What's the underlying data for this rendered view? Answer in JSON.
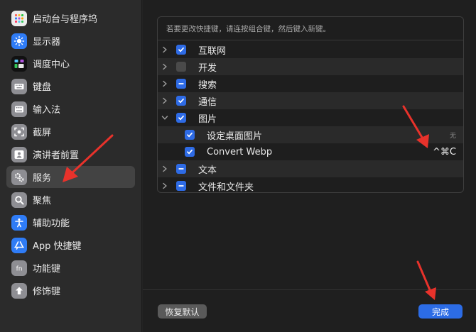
{
  "sidebar": {
    "items": [
      {
        "label": "启动台与程序坞",
        "icon": "launchpad-icon",
        "color": "#e8e8e8"
      },
      {
        "label": "显示器",
        "icon": "display-icon",
        "color": "#2f7cf6"
      },
      {
        "label": "调度中心",
        "icon": "mission-control-icon",
        "color": "#111111"
      },
      {
        "label": "键盘",
        "icon": "keyboard-icon",
        "color": "#8e8e93"
      },
      {
        "label": "输入法",
        "icon": "input-method-icon",
        "color": "#8e8e93"
      },
      {
        "label": "截屏",
        "icon": "screenshot-icon",
        "color": "#8e8e93"
      },
      {
        "label": "演讲者前置",
        "icon": "presenter-icon",
        "color": "#8e8e93"
      },
      {
        "label": "服务",
        "icon": "services-gear-icon",
        "color": "#8e8e93"
      },
      {
        "label": "聚焦",
        "icon": "spotlight-icon",
        "color": "#8e8e93"
      },
      {
        "label": "辅助功能",
        "icon": "accessibility-icon",
        "color": "#2f7cf6"
      },
      {
        "label": "App 快捷键",
        "icon": "app-store-icon",
        "color": "#2f7cf6"
      },
      {
        "label": "功能键",
        "icon": "fn-key-icon",
        "color": "#8e8e93"
      },
      {
        "label": "修饰键",
        "icon": "modifier-key-icon",
        "color": "#8e8e93"
      }
    ],
    "selected_label": "服务"
  },
  "panel": {
    "hint": "若要更改快捷键，请连按组合键，然后键入新键。",
    "rows": [
      {
        "label": "互联网",
        "state": "checked",
        "expanded": false,
        "indent": 0,
        "shortcut": ""
      },
      {
        "label": "开发",
        "state": "unchecked",
        "expanded": false,
        "indent": 0,
        "shortcut": ""
      },
      {
        "label": "搜索",
        "state": "mixed",
        "expanded": false,
        "indent": 0,
        "shortcut": ""
      },
      {
        "label": "通信",
        "state": "checked",
        "expanded": false,
        "indent": 0,
        "shortcut": ""
      },
      {
        "label": "图片",
        "state": "checked",
        "expanded": true,
        "indent": 0,
        "shortcut": ""
      },
      {
        "label": "设定桌面图片",
        "state": "checked",
        "expanded": null,
        "indent": 1,
        "shortcut": "无"
      },
      {
        "label": "Convert Webp",
        "state": "checked",
        "expanded": null,
        "indent": 1,
        "shortcut": "^⌘C"
      },
      {
        "label": "文本",
        "state": "mixed",
        "expanded": false,
        "indent": 0,
        "shortcut": ""
      },
      {
        "label": "文件和文件夹",
        "state": "mixed",
        "expanded": false,
        "indent": 0,
        "shortcut": ""
      }
    ]
  },
  "footer": {
    "reset_label": "恢复默认",
    "done_label": "完成"
  },
  "colors": {
    "accent": "#2c6ce6",
    "annotation_arrow": "#e8322b"
  }
}
